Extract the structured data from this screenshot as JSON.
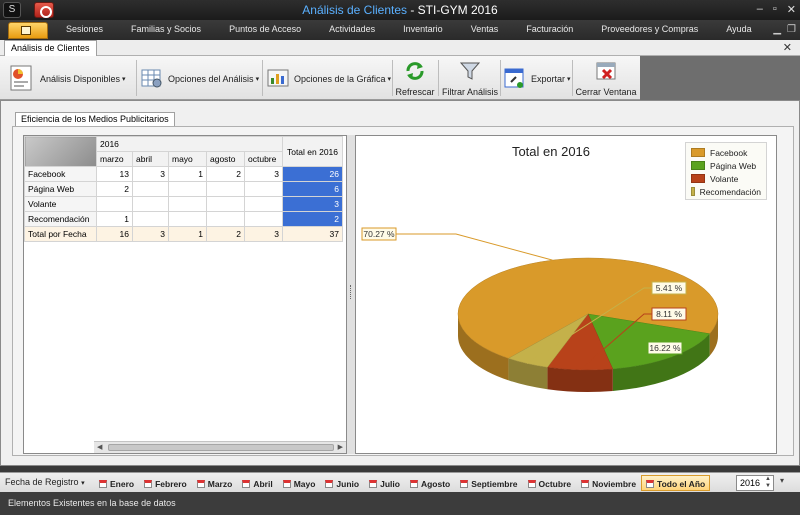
{
  "window": {
    "title_app": "Análisis de Clientes",
    "title_sep": " - ",
    "title_product": "STI-GYM 2016",
    "controls": [
      "–",
      "▫",
      "✕"
    ]
  },
  "menu": {
    "items": [
      "Sesiones",
      "Familias y Socios",
      "Puntos de Acceso",
      "Actividades",
      "Inventario",
      "Ventas",
      "Facturación",
      "Proveedores y Compras",
      "Ayuda"
    ]
  },
  "doc_tab": {
    "label": "Análisis de Clientes",
    "close": "✕"
  },
  "ribbon": {
    "analisis": "Análisis Disponibles",
    "opciones_analisis": "Opciones del Análisis",
    "opciones_grafica": "Opciones de la Gráfica",
    "refrescar": "Refrescar",
    "filtrar": "Filtrar Análisis",
    "exportar": "Exportar",
    "cerrar": "Cerrar Ventana"
  },
  "inner_tab": "Eficiencia de los Medios Publicitarios",
  "pivot": {
    "year": "2016",
    "total_header": "Total en 2016",
    "months": [
      "marzo",
      "abril",
      "mayo",
      "agosto",
      "octubre"
    ],
    "rows": [
      {
        "label": "Facebook",
        "cells": [
          "13",
          "3",
          "1",
          "2",
          "3"
        ],
        "total": "26"
      },
      {
        "label": "Página Web",
        "cells": [
          "2",
          "",
          "",
          "",
          ""
        ],
        "total": "6"
      },
      {
        "label": "Volante",
        "cells": [
          "",
          "",
          "",
          "",
          ""
        ],
        "total": "3"
      },
      {
        "label": "Recomendación",
        "cells": [
          "1",
          "",
          "",
          "",
          ""
        ],
        "total": "2"
      }
    ],
    "footer": {
      "label": "Total por Fecha",
      "cells": [
        "16",
        "3",
        "1",
        "2",
        "3"
      ],
      "total": "37"
    }
  },
  "chart_data": {
    "type": "pie",
    "title": "Total en 2016",
    "legend_position": "top-right",
    "categories": [
      "Facebook",
      "Página Web",
      "Volante",
      "Recomendación"
    ],
    "values": [
      26,
      6,
      3,
      2
    ],
    "labels": [
      "70.27 %",
      "16.22 %",
      "8.11 %",
      "5.41 %"
    ],
    "colors": [
      "#d99a2a",
      "#5aa21e",
      "#b8421a",
      "#c4b14a"
    ]
  },
  "filterbar": {
    "label": "Fecha de Registro",
    "months": [
      "Enero",
      "Febrero",
      "Marzo",
      "Abril",
      "Mayo",
      "Junio",
      "Julio",
      "Agosto",
      "Septiembre",
      "Octubre",
      "Noviembre",
      "Todo el Año"
    ],
    "active": "Todo el Año",
    "year": "2016"
  },
  "status": "Elementos Existentes en la base de datos"
}
